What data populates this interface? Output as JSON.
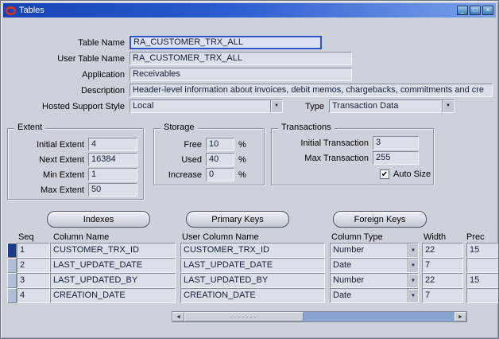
{
  "window": {
    "title": "Tables"
  },
  "icons": {
    "dropdown_arrow": "▼",
    "scrollbar_left": "◄",
    "scrollbar_right": "►",
    "grip_dots": "·······",
    "checkbox_check": "✔",
    "minimize": "_",
    "maximize": "□",
    "close": "×"
  },
  "colors": {
    "title_bar_blue": "#2a5bd0",
    "selected_field_border": "#2f55c8",
    "record_selector_active": "#1d3a8e",
    "oracle_red": "#e0301e"
  },
  "header": {
    "table_name": {
      "label": "Table Name",
      "value": "RA_CUSTOMER_TRX_ALL"
    },
    "user_table_name": {
      "label": "User Table Name",
      "value": "RA_CUSTOMER_TRX_ALL"
    },
    "application": {
      "label": "Application",
      "value": "Receivables"
    },
    "description": {
      "label": "Description",
      "value": "Header-level information about invoices, debit memos, chargebacks, commitments and cre"
    },
    "hosted_support_style": {
      "label": "Hosted Support Style",
      "value": "Local"
    },
    "type": {
      "label": "Type",
      "value": "Transaction Data"
    }
  },
  "extent": {
    "legend": "Extent",
    "initial_extent": {
      "label": "Initial Extent",
      "value": "4"
    },
    "next_extent": {
      "label": "Next Extent",
      "value": "16384"
    },
    "min_extent": {
      "label": "Min Extent",
      "value": "1"
    },
    "max_extent": {
      "label": "Max Extent",
      "value": "50"
    }
  },
  "storage": {
    "legend": "Storage",
    "free": {
      "label": "Free",
      "value": "10",
      "unit": "%"
    },
    "used": {
      "label": "Used",
      "value": "40",
      "unit": "%"
    },
    "increase": {
      "label": "Increase",
      "value": "0",
      "unit": "%"
    }
  },
  "transactions": {
    "legend": "Transactions",
    "initial_transaction": {
      "label": "Initial Transaction",
      "value": "3"
    },
    "max_transaction": {
      "label": "Max Transaction",
      "value": "255"
    },
    "auto_size": {
      "label": "Auto Size",
      "checked": true
    }
  },
  "buttons": {
    "indexes": "Indexes",
    "primary_keys": "Primary Keys",
    "foreign_keys": "Foreign Keys"
  },
  "grid": {
    "headers": {
      "seq": "Seq",
      "column_name": "Column Name",
      "user_column_name": "User Column Name",
      "column_type": "Column Type",
      "width": "Width",
      "prec": "Prec"
    },
    "rows": [
      {
        "seq": "1",
        "column_name": "CUSTOMER_TRX_ID",
        "user_column_name": "CUSTOMER_TRX_ID",
        "column_type": "Number",
        "width": "22",
        "prec": "15"
      },
      {
        "seq": "2",
        "column_name": "LAST_UPDATE_DATE",
        "user_column_name": "LAST_UPDATE_DATE",
        "column_type": "Date",
        "width": "7",
        "prec": ""
      },
      {
        "seq": "3",
        "column_name": "LAST_UPDATED_BY",
        "user_column_name": "LAST_UPDATED_BY",
        "column_type": "Number",
        "width": "22",
        "prec": "15"
      },
      {
        "seq": "4",
        "column_name": "CREATION_DATE",
        "user_column_name": "CREATION_DATE",
        "column_type": "Date",
        "width": "7",
        "prec": ""
      }
    ]
  }
}
